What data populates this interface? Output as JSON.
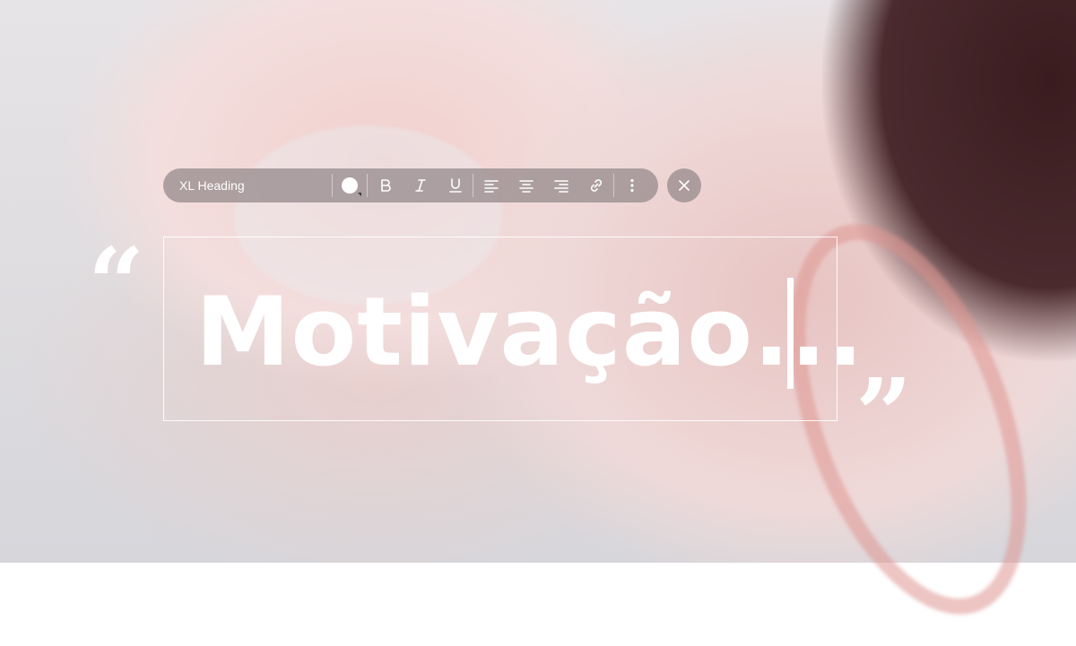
{
  "toolbar": {
    "text_style": "XL Heading",
    "text_color": "#ffffff",
    "buttons": [
      "text-color",
      "bold",
      "italic",
      "underline",
      "align-left",
      "align-center",
      "align-right",
      "link",
      "more"
    ]
  },
  "quotes": {
    "open": "“",
    "close": "”"
  },
  "heading": {
    "text": "Motivação..."
  },
  "colors": {
    "toolbar_bg": "#968a8c",
    "text": "#ffffff"
  }
}
